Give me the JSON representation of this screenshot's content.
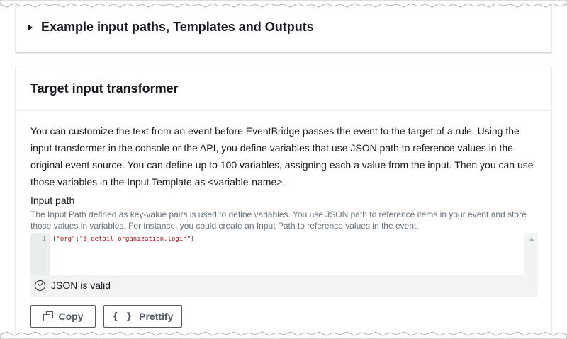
{
  "expander": {
    "title": "Example input paths, Templates and Outputs"
  },
  "transformer": {
    "title": "Target input transformer",
    "description": "You can customize the text from an event before EventBridge passes the event to the target of a rule. Using the input transformer in the console or the API, you define variables that use JSON path to reference values in the original event source. You can define up to 100 variables, assigning each a value from the input. Then you can use those variables in the Input Template as <variable-name>.",
    "input_path": {
      "label": "Input path",
      "description": "The Input Path defined as key-value pairs is used to define variables. You use JSON path to reference items in your event and store those values in variables. For instance, you could create an Input Path to reference values in the event.",
      "line_number": "1",
      "code": {
        "open": "{",
        "key": "\"org\"",
        "colon": ":",
        "value": "\"$.detail.organization.login\"",
        "close": "}"
      },
      "validation_text": "JSON is valid"
    },
    "buttons": {
      "copy_label": "Copy",
      "prettify_label": "Prettify",
      "prettify_icon": "{ }"
    }
  },
  "colors": {
    "text": "#16191f",
    "muted": "#687078",
    "border": "#d5dbdb",
    "button": "#545b64",
    "json_string": "#a31515"
  }
}
